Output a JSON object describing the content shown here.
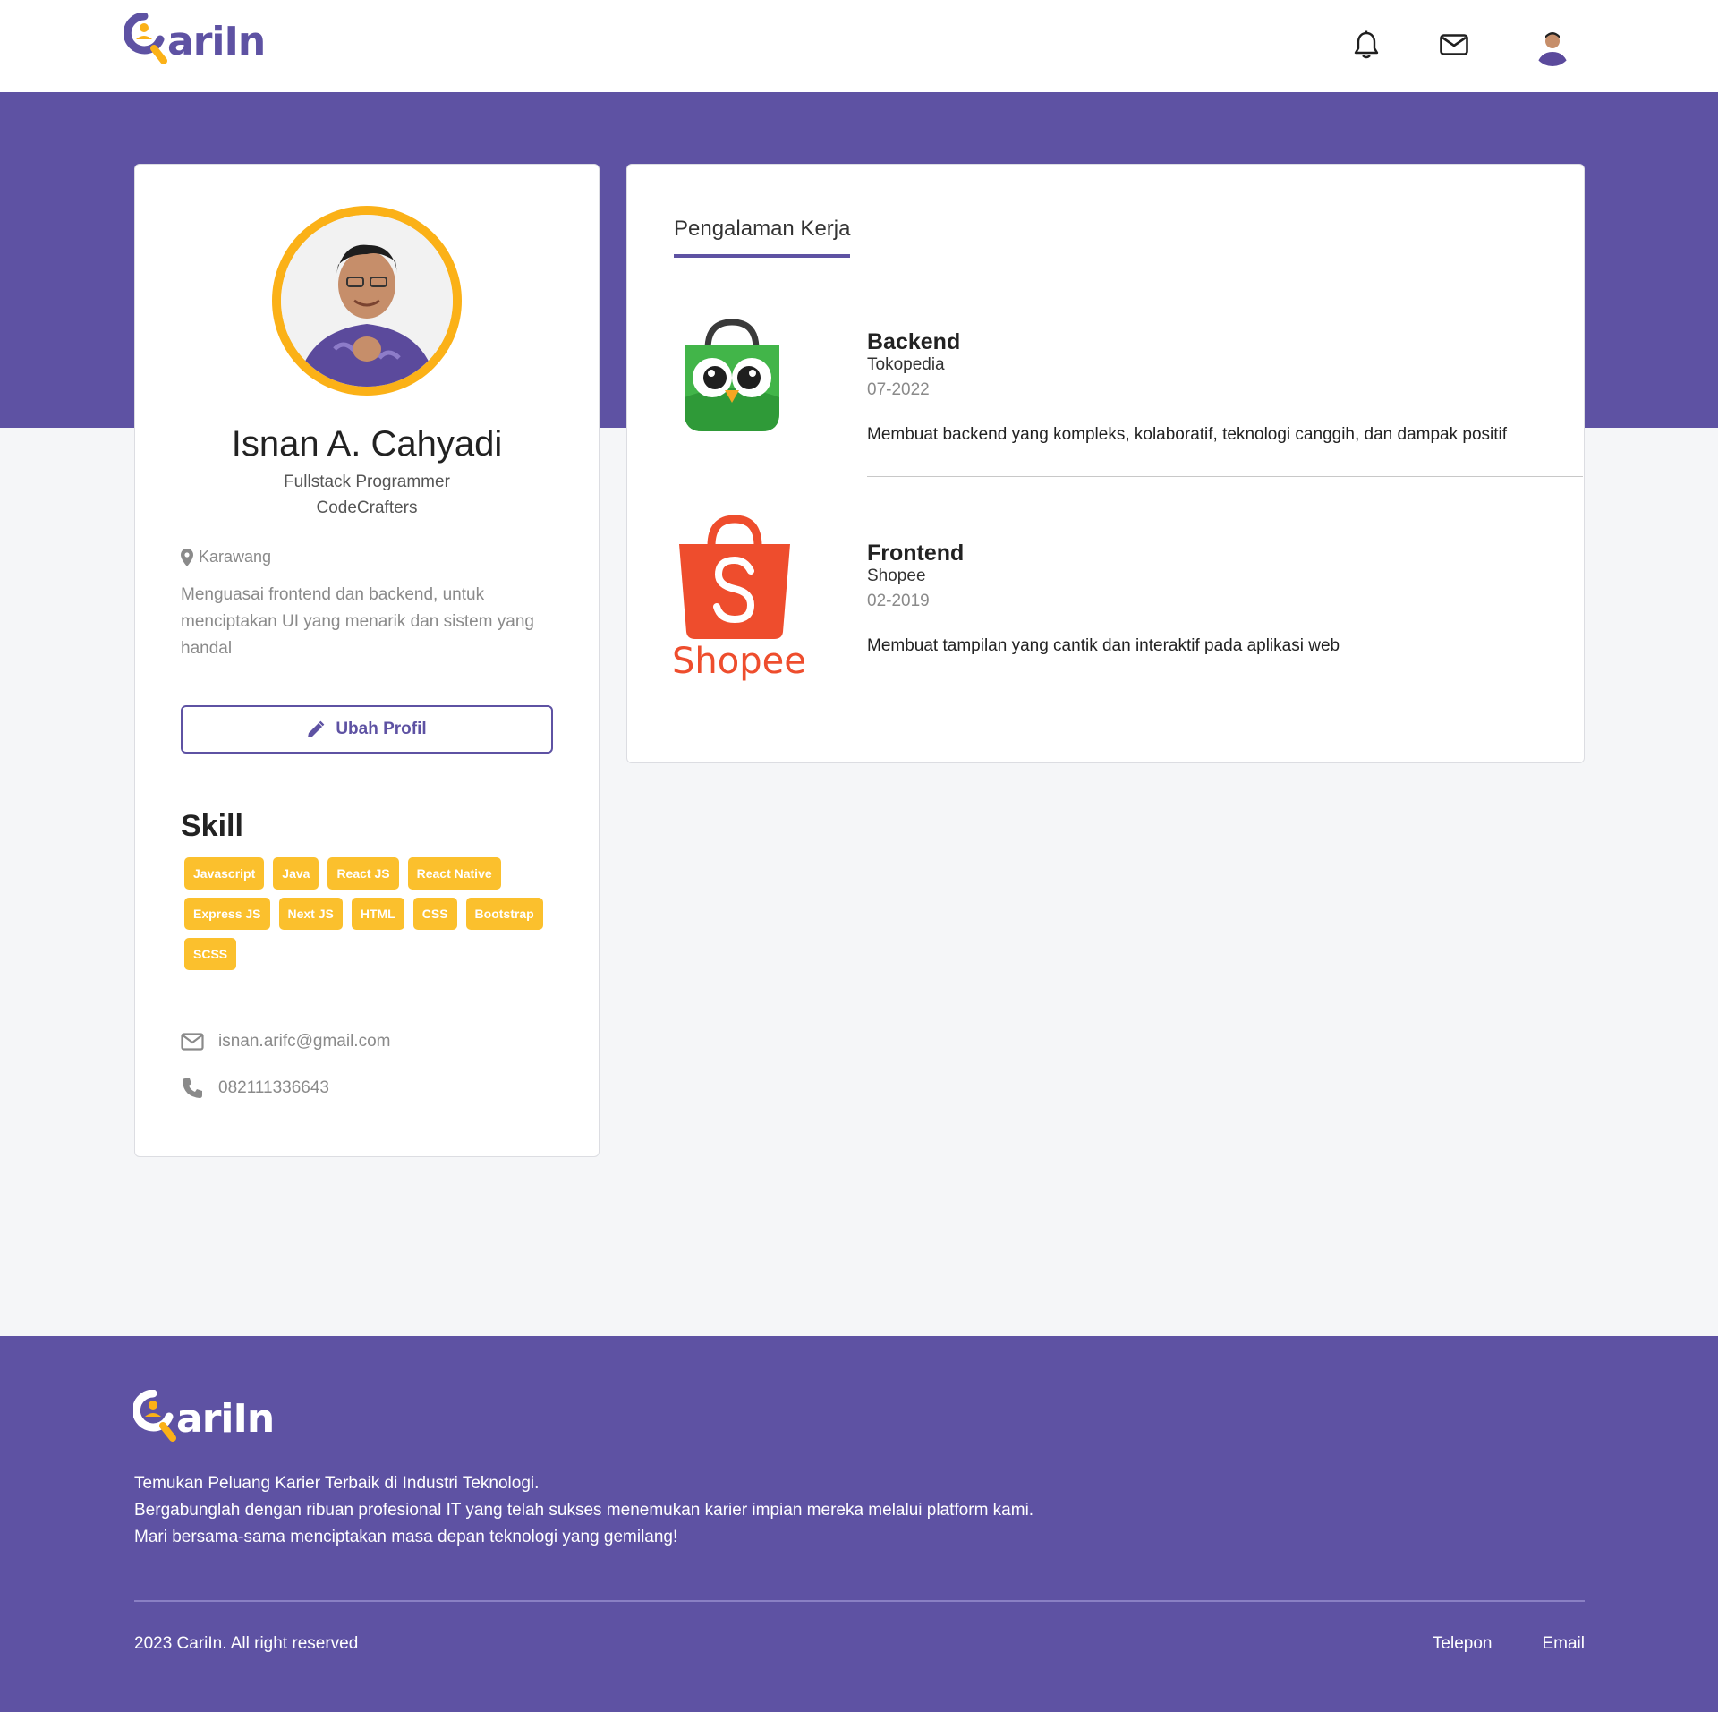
{
  "brand": {
    "name": "CariIn",
    "primary_color": "#5e52a3",
    "accent_color": "#fbb117"
  },
  "navbar": {
    "notification_icon": "bell-icon",
    "message_icon": "mail-icon"
  },
  "profile": {
    "name": "Isnan A. Cahyadi",
    "role": "Fullstack Programmer",
    "company": "CodeCrafters",
    "location": "Karawang",
    "bio": "Menguasai frontend dan backend, untuk menciptakan UI yang menarik dan sistem yang handal",
    "edit_label": "Ubah Profil",
    "skills_title": "Skill",
    "skills": [
      "Javascript",
      "Java",
      "React JS",
      "React Native",
      "Express JS",
      "Next JS",
      "HTML",
      "CSS",
      "Bootstrap",
      "SCSS"
    ],
    "email": "isnan.arifc@gmail.com",
    "phone": "082111336643"
  },
  "experience": {
    "tab_label": "Pengalaman Kerja",
    "items": [
      {
        "role": "Backend",
        "company": "Tokopedia",
        "date": "07-2022",
        "description": "Membuat backend yang kompleks, kolaboratif, teknologi canggih, dan dampak positif"
      },
      {
        "role": "Frontend",
        "company": "Shopee",
        "date": "02-2019",
        "description": "Membuat tampilan yang cantik dan interaktif pada aplikasi web",
        "logo_text": "Shopee"
      }
    ]
  },
  "footer": {
    "tagline_1": "Temukan Peluang Karier Terbaik di Industri Teknologi.",
    "tagline_2": "Bergabunglah dengan ribuan profesional IT yang telah sukses menemukan karier impian mereka melalui platform kami.",
    "tagline_3": "Mari bersama-sama menciptakan masa depan teknologi yang gemilang!",
    "copyright": "2023 CariIn. All right reserved",
    "links": [
      "Telepon",
      "Email"
    ]
  }
}
